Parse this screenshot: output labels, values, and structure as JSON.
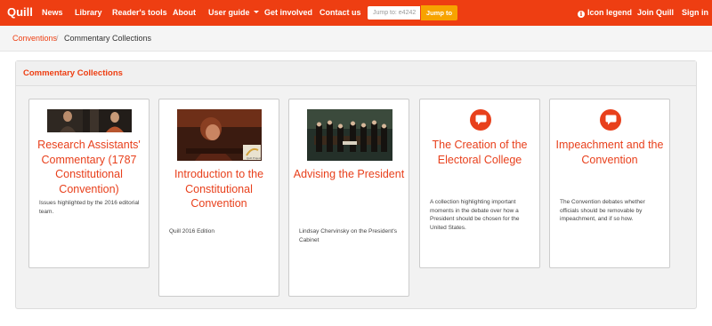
{
  "navbar": {
    "brand": "Quill",
    "links": {
      "news": "News",
      "library": "Library",
      "readers_tools": "Reader's tools",
      "about": "About",
      "user_guide": "User guide",
      "get_involved": "Get involved",
      "contact_us": "Contact us"
    },
    "jump": {
      "placeholder": "Jump to: e4242",
      "button_label": "Jump to"
    },
    "right": {
      "icon_legend": "Icon legend",
      "join": "Join Quill",
      "sign_in": "Sign in"
    }
  },
  "breadcrumb": {
    "parent": "Conventions",
    "separator": "/",
    "current": "Commentary Collections"
  },
  "panel": {
    "title": "Commentary Collections"
  },
  "cards": [
    {
      "title": "Research Assistants' Commentary (1787 Constitutional Convention)",
      "description": "Issues highlighted by the 2016 editorial team.",
      "thumb": "video-two-people"
    },
    {
      "title": "Introduction to the Constitutional Convention",
      "description": "Quill 2016 Edition",
      "thumb": "video-writer"
    },
    {
      "title": "Advising the President",
      "description": "Lindsay Chervinsky on the President's Cabinet",
      "thumb": "painting-cabinet"
    },
    {
      "title": "The Creation of the Electoral College",
      "description": "A collection highlighting important moments in the debate over how a President should be chosen for the United States.",
      "thumb": "comment-icon"
    },
    {
      "title": "Impeachment and the Convention",
      "description": "The Convention debates whether officials should be removable by impeachment, and if so how.",
      "thumb": "comment-icon"
    }
  ],
  "colors": {
    "brand": "#ee3e12",
    "jump_button": "#f7a300",
    "card_title": "#e8401c"
  }
}
